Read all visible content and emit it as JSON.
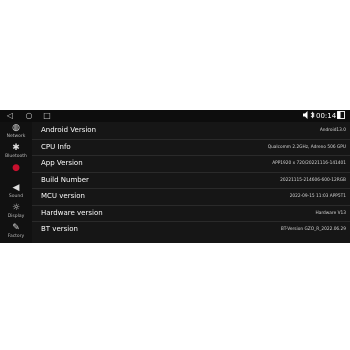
{
  "statusbar": {
    "nav_back": "◁",
    "nav_home": "○",
    "nav_recents": "□",
    "sound_icon": "speaker-icon",
    "bluetooth_icon": "bluetooth-icon",
    "time": "00:14",
    "back_icon": "back-icon"
  },
  "sidebar": {
    "items": [
      {
        "label": "Network",
        "icon": "globe-icon",
        "glyph": "◍"
      },
      {
        "label": "Bluetooth",
        "icon": "bluetooth-icon",
        "glyph": "✱"
      },
      {
        "label": "",
        "icon": "car-icon",
        "glyph": "●"
      },
      {
        "label": "Sound",
        "icon": "speaker-icon",
        "glyph": "◀"
      },
      {
        "label": "Display",
        "icon": "sun-icon",
        "glyph": "☼"
      },
      {
        "label": "Factory",
        "icon": "wrench-icon",
        "glyph": "✎"
      }
    ],
    "active_index": 2,
    "accent_color": "#c8102e"
  },
  "info_rows": [
    {
      "label": "Android Version",
      "value": "Android13.0"
    },
    {
      "label": "CPU Info",
      "value": "Qualcomm 2.2GHz, Adreno 506 GPU"
    },
    {
      "label": "App Version",
      "value": "APP1920 x 720/20221116-141401"
    },
    {
      "label": "Build Number",
      "value": "20221115-214606-600-12RGB"
    },
    {
      "label": "MCU version",
      "value": "2022-09-15 11:03 APP5T1"
    },
    {
      "label": "Hardware version",
      "value": "Hardware V13"
    },
    {
      "label": "BT version",
      "value": "BT-Version GZO_R_2022.06.29"
    }
  ]
}
